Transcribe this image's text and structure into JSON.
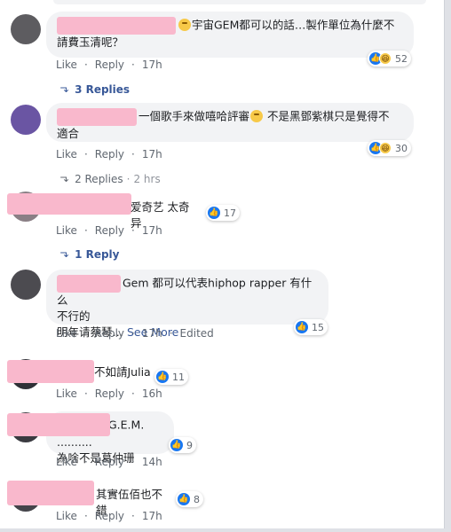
{
  "actions": {
    "like": "Like",
    "reply": "Reply",
    "separator": "·"
  },
  "comments": [
    {
      "text": "宇宙GEM都可以的話…製作單位為什麼不",
      "text2": "請費玉清呢？",
      "time": "17h",
      "reaction_count": "52",
      "replies_label": "3 Replies"
    },
    {
      "text": "一個歌手來做嘻哈評審",
      "text_b": "不是黑鄧紫棋只是覺得不",
      "text2": "適合",
      "time": "17h",
      "reaction_count": "30",
      "replies_label": "2 Replies",
      "replies_ago": "2 hrs"
    },
    {
      "text": "爱奇艺 太奇异",
      "time": "17h",
      "reaction_count": "17",
      "replies_label": "1 Reply"
    },
    {
      "text": "Gem 都可以代表hiphop rapper 有什么",
      "text2": "不行的",
      "text3": "明年请蔡琴…",
      "see_more": "See More",
      "time": "17h",
      "edited": "Edited",
      "reaction_count": "15"
    },
    {
      "text": "不如請Julia",
      "time": "16h",
      "reaction_count": "11"
    },
    {
      "text": "G.E.M. ..........",
      "text2": "為啥不是葛仲珊",
      "time": "14h",
      "reaction_count": "9"
    },
    {
      "text": "其實伍佰也不錯",
      "time": "17h",
      "reaction_count": "8"
    }
  ],
  "colors": {
    "bubble": "#f2f3f5",
    "link": "#385898",
    "meta": "#606770",
    "like": "#1877f2",
    "redaction": "#f9b8cc"
  },
  "icons": [
    "like-icon",
    "haha-icon",
    "eye-roll-emoji-icon",
    "reply-arrow-icon"
  ]
}
